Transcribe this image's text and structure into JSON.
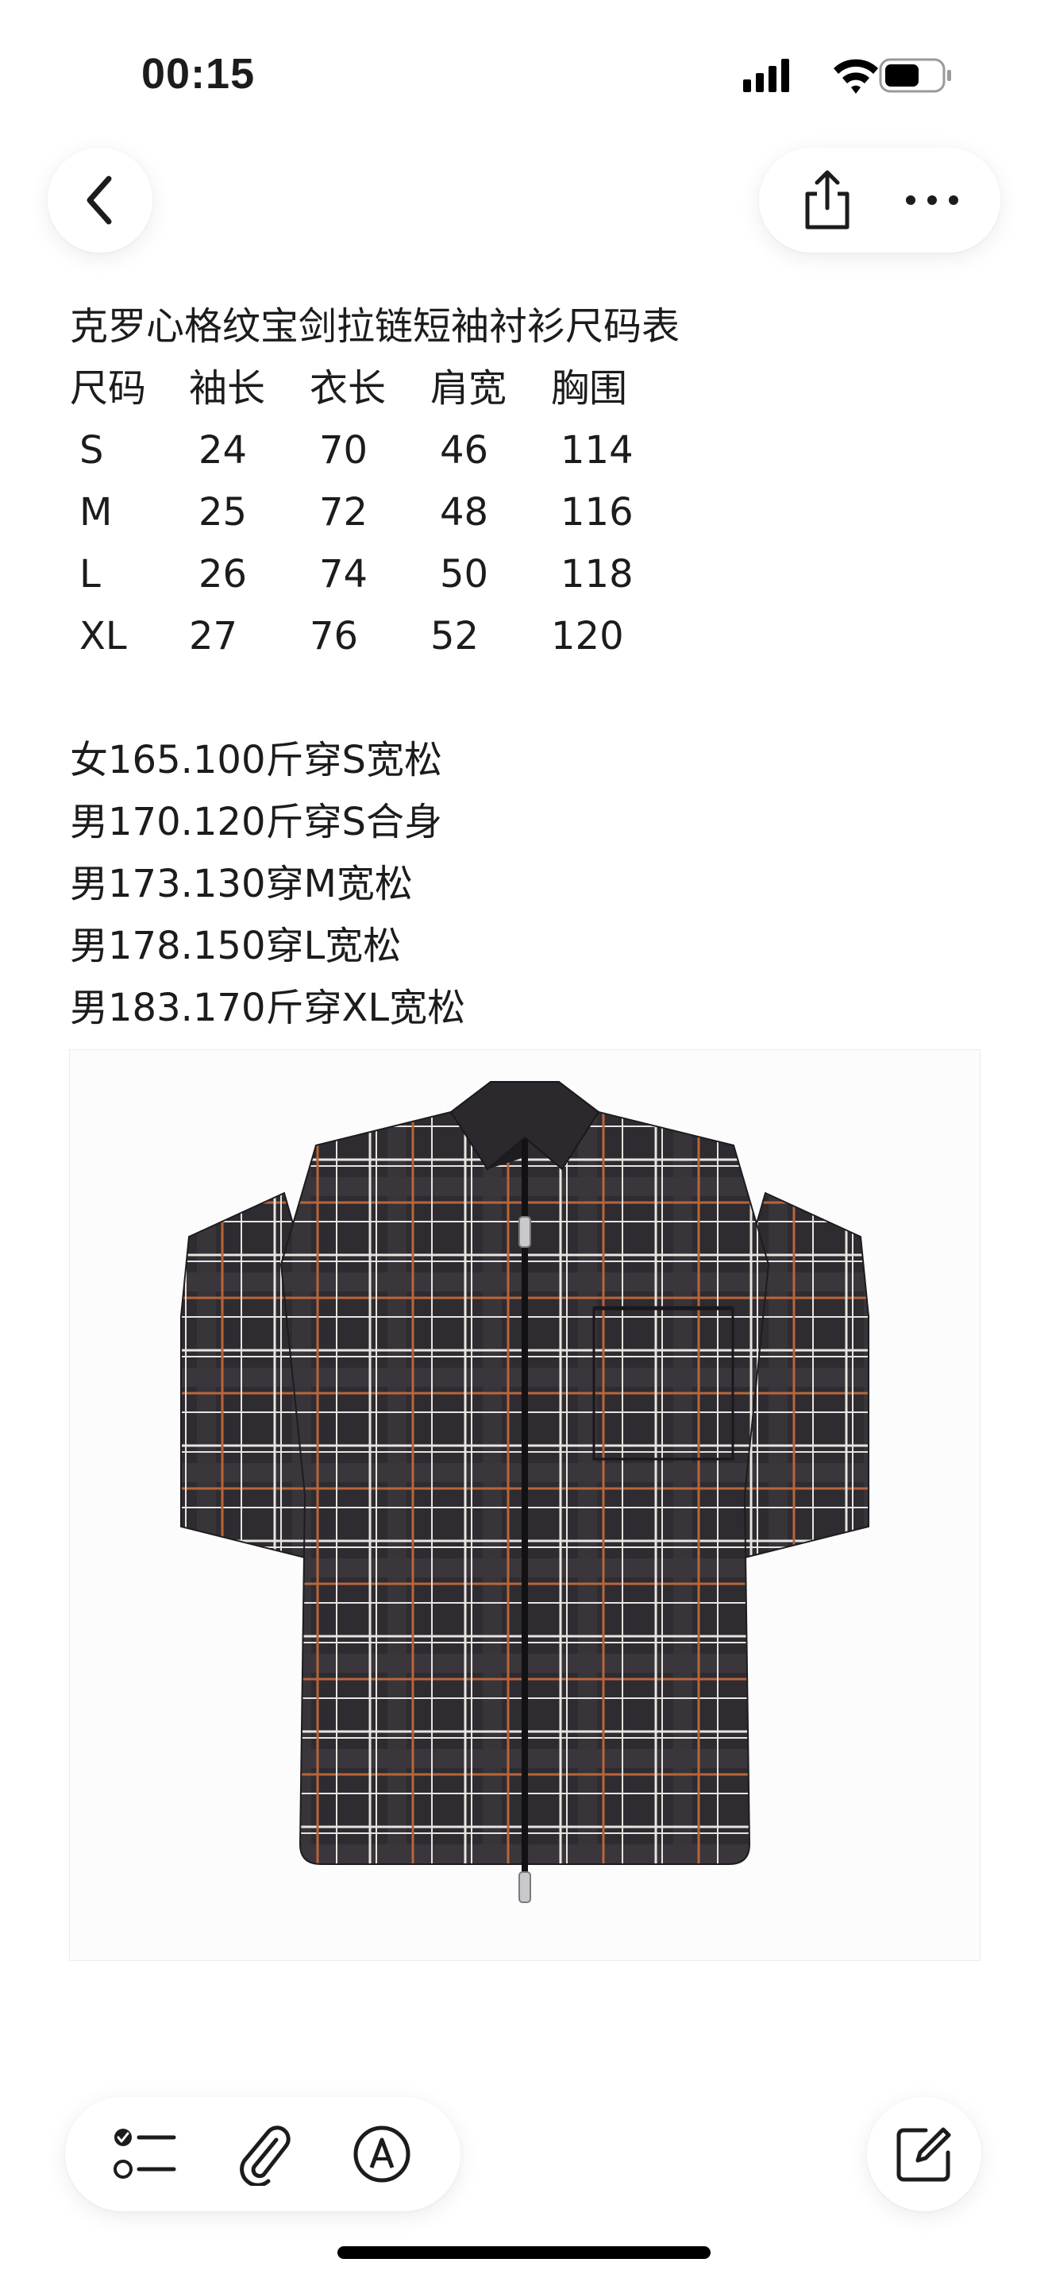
{
  "status_bar": {
    "time": "00:15",
    "icons": [
      "signal-icon",
      "wifi-icon",
      "battery-icon"
    ]
  },
  "nav": {
    "back_icon": "chevron-left-icon",
    "share_icon": "share-icon",
    "more_icon": "more-icon"
  },
  "note": {
    "title": "克罗心格纹宝剑拉链短袖衬衫尺码表",
    "table": {
      "headers": [
        "尺码",
        "袖长",
        "衣长",
        "肩宽",
        "胸围"
      ],
      "rows": [
        [
          "S",
          "24",
          "70",
          "46",
          "114"
        ],
        [
          "M",
          "25",
          "72",
          "48",
          "116"
        ],
        [
          "L",
          "26",
          "74",
          "50",
          "118"
        ],
        [
          "XL",
          "27",
          "76",
          "52",
          "120"
        ]
      ]
    },
    "fit_guide": [
      "女165.100斤穿S宽松",
      "男170.120斤穿S合身",
      "男173.130穿M宽松",
      "男178.150穿L宽松",
      "男183.170斤穿XL宽松"
    ]
  },
  "image": {
    "subject": "plaid-zip-shirt",
    "colors": {
      "base": "#2e2b31",
      "white_line": "#e8e4df",
      "orange_line": "#b8663a"
    }
  },
  "toolbar": {
    "checklist_icon": "checklist-icon",
    "attachment_icon": "paperclip-icon",
    "markup_icon": "markup-pen-icon",
    "compose_icon": "compose-icon"
  },
  "colors": {
    "text": "#1c1c1e",
    "background": "#ffffff",
    "button_bg": "#ffffff"
  }
}
